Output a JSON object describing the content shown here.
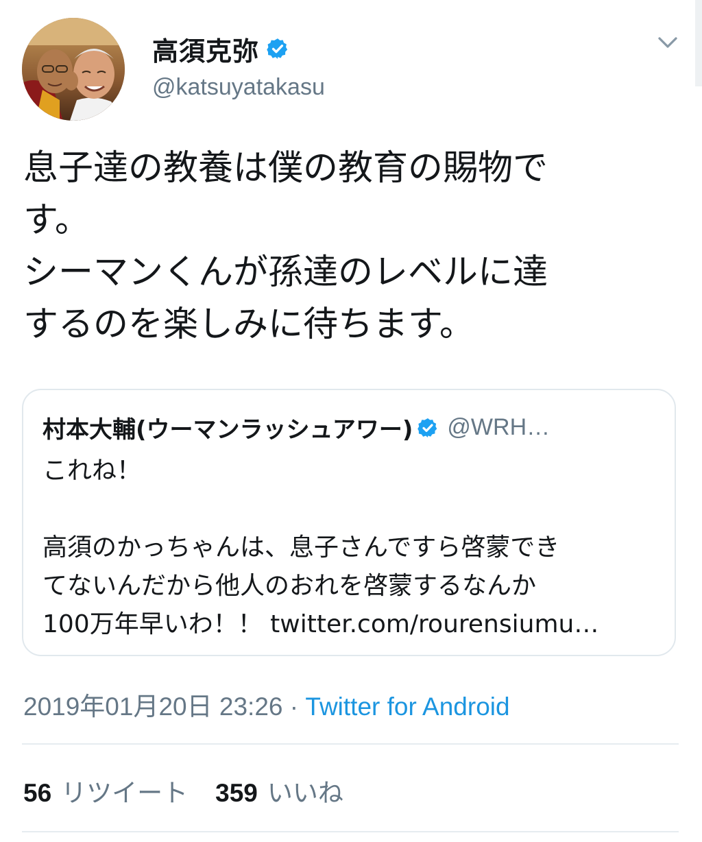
{
  "author": {
    "display_name": "高須克弥",
    "handle": "@katsuyatakasu",
    "verified": true
  },
  "tweet": {
    "text": "息子達の教養は僕の教育の賜物で\nす。\nシーマンくんが孫達のレベルに達\nするのを楽しみに待ちます。"
  },
  "quoted_tweet": {
    "display_name": "村本大輔(ウーマンラッシュアワー)",
    "handle": "@WRH…",
    "verified": true,
    "text": "これね！\n\n高須のかっちゃんは、息子さんですら啓蒙でき\nてないんだから他人のおれを啓蒙するなんか\n100万年早いわ！！ twitter.com/rourensiumu…"
  },
  "meta": {
    "timestamp": "2019年01月20日 23:26",
    "separator": " · ",
    "source": "Twitter for Android"
  },
  "stats": {
    "retweets": {
      "count": "56",
      "label": "リツイート"
    },
    "likes": {
      "count": "359",
      "label": "いいね"
    }
  },
  "colors": {
    "text": "#14171a",
    "secondary": "#657786",
    "link": "#1b95e0",
    "verified": "#1da1f2",
    "border": "#e1e8ed"
  },
  "icons": [
    "avatar-photo",
    "verified-badge-icon",
    "chevron-down-icon"
  ]
}
